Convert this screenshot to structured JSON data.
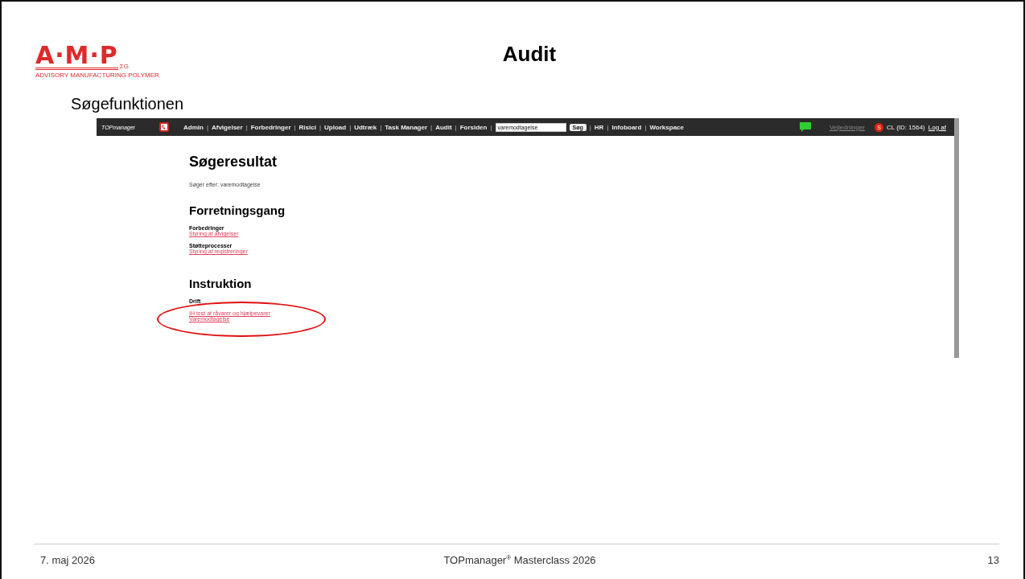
{
  "slide": {
    "title": "Audit",
    "section_label": "Søgefunktionen"
  },
  "logo": {
    "mark": "A·M·P",
    "suffix": "ΣG",
    "tagline": "ADVISORY MANUFACTURING POLYMER"
  },
  "screenshot": {
    "nav": {
      "brand": "TOPmanager",
      "separator": "|",
      "links": [
        "Admin",
        "Afvigelser",
        "Forbedringer",
        "Risici",
        "Upload",
        "Udtræk",
        "Task Manager",
        "Audit",
        "Forsiden"
      ],
      "search_value": "varemodtagelse",
      "search_button": "Søg",
      "links_after": [
        "HR",
        "Infoboard",
        "Workspace"
      ],
      "guide_link": "Vejledninger",
      "user_badge": "S",
      "user": "CL (ID: 1564)",
      "logout": "Log af"
    },
    "page": {
      "title": "Søgeresultat",
      "query": "Søger efter: varemodtagelse",
      "sections": [
        {
          "heading": "Forretningsgang",
          "groups": [
            {
              "label": "Forbedringer",
              "circled": false,
              "links": [
                "Styring af afvigelser"
              ]
            },
            {
              "label": "Støtteprocesser",
              "circled": false,
              "links": [
                "Styring af registreringer"
              ]
            }
          ]
        },
        {
          "heading": "Instruktion",
          "groups": [
            {
              "label": "Drift",
              "circled": true,
              "links": [
                "IH test af råvarer og hjælpevarer",
                "Varemodtagelse"
              ]
            }
          ]
        }
      ]
    }
  },
  "footer": {
    "date": "7. maj 2026",
    "center": "TOPmanager$^{®}$ Masterclass 2026",
    "page": "13"
  }
}
